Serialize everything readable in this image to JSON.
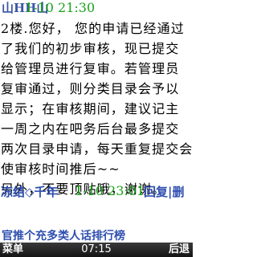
{
  "post": {
    "author": "山HH山",
    "time": "1-10 21:30",
    "lines": [
      "2楼.您好， 您的申请已经通过",
      "了我们的初步审核，现已提交",
      "给管理员进行复审。若管理员",
      "复审通过，则分类目录会予以",
      "显示；在审核期间，建议记主",
      "一周之内在吧务后台最多提交",
      "两次目录申请，每天重复提交会",
      "使审核时间推后~~",
      "另外，不要顶贴哦，谢谢。"
    ]
  },
  "reply": {
    "author": "冻结◇千年",
    "time": "1-10 23:01",
    "action": "回复|删"
  },
  "next_post_title": "官推个充多类人话排行榜",
  "softkeys": {
    "left": "菜单",
    "clock": "07:15",
    "right": "后退"
  }
}
